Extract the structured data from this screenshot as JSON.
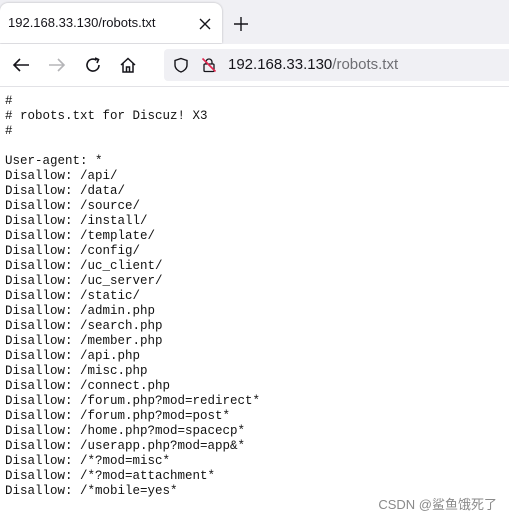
{
  "tab": {
    "title": "192.168.33.130/robots.txt"
  },
  "url": {
    "host": "192.168.33.130",
    "path": "/robots.txt"
  },
  "icons": {
    "close": "close-icon",
    "new_tab": "plus-icon",
    "back": "arrow-left-icon",
    "forward": "arrow-right-icon",
    "reload": "reload-icon",
    "home": "home-icon",
    "shield": "shield-icon",
    "insecure": "lock-slash-icon"
  },
  "content_lines": [
    "#",
    "# robots.txt for Discuz! X3",
    "#",
    "",
    "User-agent: *",
    "Disallow: /api/",
    "Disallow: /data/",
    "Disallow: /source/",
    "Disallow: /install/",
    "Disallow: /template/",
    "Disallow: /config/",
    "Disallow: /uc_client/",
    "Disallow: /uc_server/",
    "Disallow: /static/",
    "Disallow: /admin.php",
    "Disallow: /search.php",
    "Disallow: /member.php",
    "Disallow: /api.php",
    "Disallow: /misc.php",
    "Disallow: /connect.php",
    "Disallow: /forum.php?mod=redirect*",
    "Disallow: /forum.php?mod=post*",
    "Disallow: /home.php?mod=spacecp*",
    "Disallow: /userapp.php?mod=app&*",
    "Disallow: /*?mod=misc*",
    "Disallow: /*?mod=attachment*",
    "Disallow: /*mobile=yes*"
  ],
  "watermark": "CSDN @鲨鱼饿死了"
}
